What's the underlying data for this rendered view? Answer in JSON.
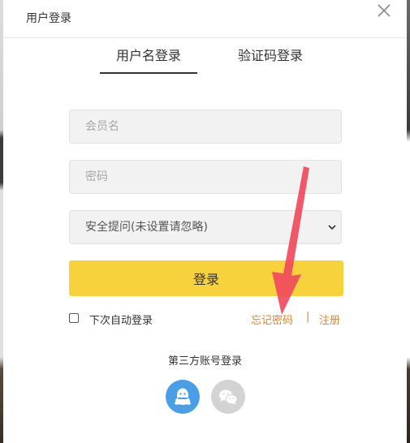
{
  "dialog": {
    "title": "用户登录"
  },
  "tabs": [
    {
      "label": "用户名登录",
      "active": true
    },
    {
      "label": "验证码登录",
      "active": false
    }
  ],
  "form": {
    "username_placeholder": "会员名",
    "password_placeholder": "密码",
    "security_question_selected": "安全提问(未设置请忽略)",
    "login_label": "登录",
    "remember_label": "下次自动登录",
    "remember_checked": false,
    "forgot_label": "忘记密码",
    "separator": "|",
    "register_label": "注册"
  },
  "third_party": {
    "title": "第三方账号登录",
    "providers": [
      {
        "name": "qq",
        "icon": "qq-icon",
        "color": "#4a9ee6"
      },
      {
        "name": "wechat",
        "icon": "wechat-icon",
        "color": "#d3d3d3"
      }
    ]
  },
  "colors": {
    "accent": "#f8d23c",
    "link": "#e0852b",
    "annotation_arrow": "#f04a5c"
  }
}
